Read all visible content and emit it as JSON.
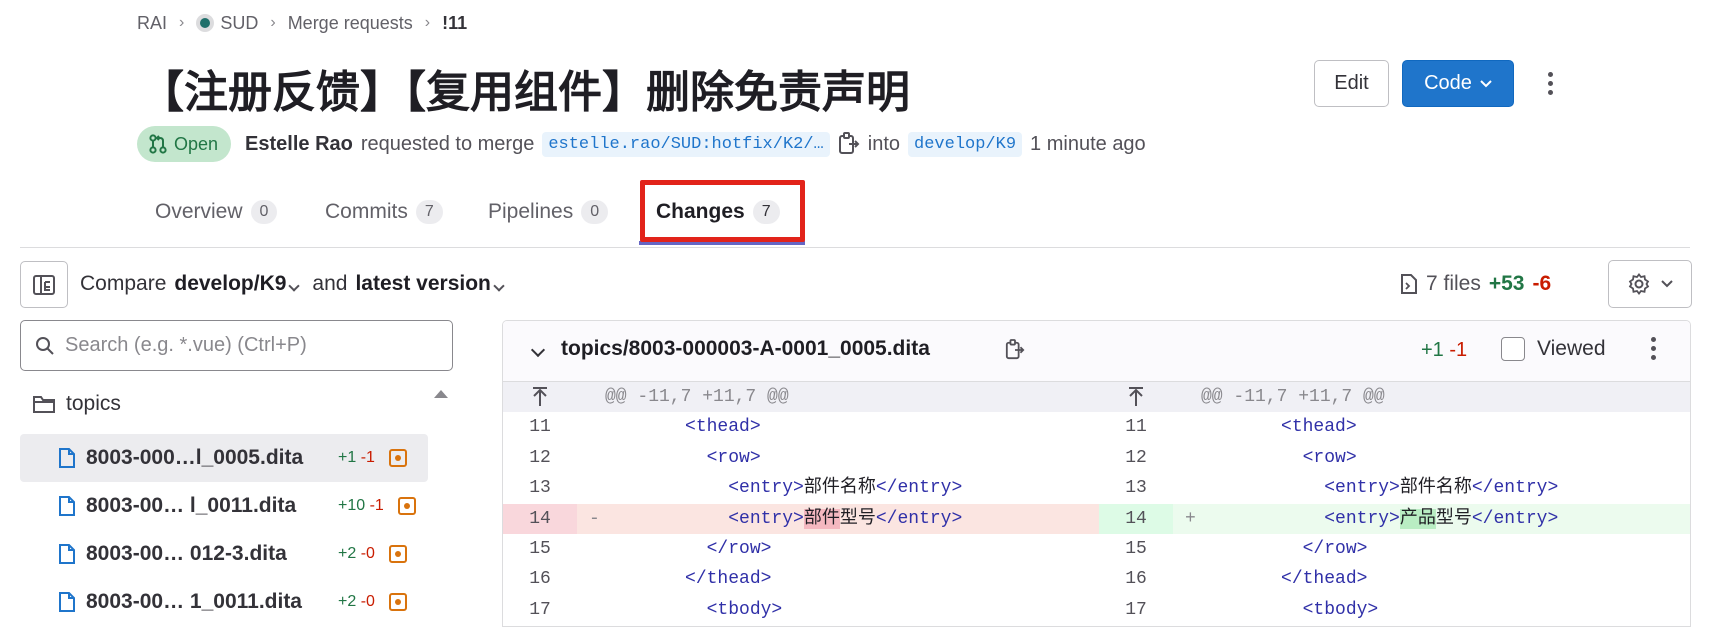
{
  "breadcrumb": {
    "items": [
      "RAI",
      "SUD",
      "Merge requests",
      "!11"
    ]
  },
  "mr": {
    "title": "【注册反馈】【复用组件】删除免责声明",
    "status": "Open",
    "author": "Estelle Rao",
    "requested_text": "requested to merge",
    "source_branch": "estelle.rao/SUD:hotfix/K2/…",
    "into_text": "into",
    "target_branch": "develop/K9",
    "time": "1 minute ago"
  },
  "header_actions": {
    "edit_label": "Edit",
    "code_label": "Code"
  },
  "tabs": [
    {
      "label": "Overview",
      "count": "0"
    },
    {
      "label": "Commits",
      "count": "7"
    },
    {
      "label": "Pipelines",
      "count": "0"
    },
    {
      "label": "Changes",
      "count": "7",
      "active": true
    }
  ],
  "compare": {
    "compare_label": "Compare",
    "target": "develop/K9",
    "and_label": "and",
    "version": "latest version"
  },
  "stats": {
    "files": "7 files",
    "added": "+53",
    "removed": "-6"
  },
  "search": {
    "placeholder": "Search (e.g. *.vue) (Ctrl+P)"
  },
  "file_tree": {
    "folder": "topics",
    "files": [
      {
        "name": "8003-000…l_0005.dita",
        "added": "+1",
        "removed": "-1"
      },
      {
        "name": "8003-00… l_0011.dita",
        "added": "+10",
        "removed": "-1"
      },
      {
        "name": "8003-00… ‌012-3.dita",
        "added": "+2",
        "removed": "-0"
      },
      {
        "name": "8003-00… 1_0011.dita",
        "added": "+2",
        "removed": "-0"
      }
    ]
  },
  "diff": {
    "file_path": "topics/8003-000003-A-0001_0005.dita",
    "added": "+1",
    "removed": "-1",
    "viewed_label": "Viewed",
    "hunk_header": "@@ -11,7 +11,7 @@",
    "lines": [
      {
        "num": "11",
        "indent": "          ",
        "text": "<thead>"
      },
      {
        "num": "12",
        "indent": "            ",
        "text": "<row>"
      },
      {
        "num": "13",
        "indent": "              ",
        "pre": "<entry>",
        "mid": "部件名称",
        "post": "</entry>"
      },
      {
        "num": "14",
        "indent": "              ",
        "pre": "<entry>",
        "old_hl": "部件",
        "new_hl": "产品",
        "mid": "型号",
        "post": "</entry>",
        "changed": true
      },
      {
        "num": "15",
        "indent": "            ",
        "text": "</row>"
      },
      {
        "num": "16",
        "indent": "          ",
        "text": "</thead>"
      },
      {
        "num": "17",
        "indent": "            ",
        "text": "<tbody>"
      }
    ]
  },
  "colors": {
    "accent": "#1f75cb",
    "highlight_box": "#e2231a",
    "tab_underline": "#6666c4",
    "added": "#217645",
    "removed": "#c91c00"
  }
}
